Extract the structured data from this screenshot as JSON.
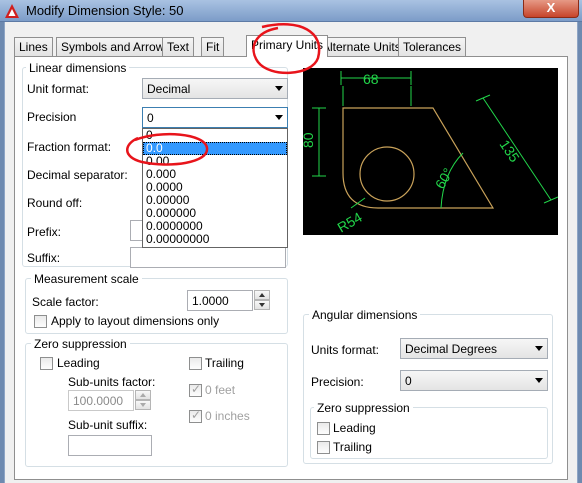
{
  "window": {
    "title": "Modify Dimension Style: 50",
    "close_label": "X"
  },
  "tabs": [
    {
      "label": "Lines",
      "active": false
    },
    {
      "label": "Symbols and Arrows",
      "active": false
    },
    {
      "label": "Text",
      "active": false
    },
    {
      "label": "Fit",
      "active": false
    },
    {
      "label": "Primary Units",
      "active": true
    },
    {
      "label": "Alternate Units",
      "active": false
    },
    {
      "label": "Tolerances",
      "active": false
    }
  ],
  "linear": {
    "title": "Linear dimensions",
    "unit_format_label": "Unit format:",
    "unit_format_value": "Decimal",
    "precision_label": "Precision",
    "precision_value": "0",
    "fraction_format_label": "Fraction format:",
    "decimal_separator_label": "Decimal separator:",
    "round_off_label": "Round off:",
    "prefix_label": "Prefix:",
    "suffix_label": "Suffix:"
  },
  "precision_options": [
    "0",
    "0.0",
    "0.00",
    "0.000",
    "0.0000",
    "0.00000",
    "0.000000",
    "0.0000000",
    "0.00000000"
  ],
  "precision_highlighted": "0.0",
  "measurement": {
    "title": "Measurement scale",
    "scale_label": "Scale factor:",
    "scale_value": "1.0000",
    "apply_layout_label": "Apply to layout dimensions only"
  },
  "zero_linear": {
    "title": "Zero suppression",
    "leading_label": "Leading",
    "trailing_label": "Trailing",
    "subunits_factor_label": "Sub-units factor:",
    "subunits_factor_value": "100.0000",
    "feet_label": "0 feet",
    "inches_label": "0 inches",
    "subunit_suffix_label": "Sub-unit suffix:"
  },
  "angular": {
    "title": "Angular dimensions",
    "units_format_label": "Units format:",
    "units_format_value": "Decimal Degrees",
    "precision_label": "Precision:",
    "precision_value": "0",
    "zero_title": "Zero suppression",
    "leading_label": "Leading",
    "trailing_label": "Trailing"
  },
  "preview": {
    "dim_top": "68",
    "dim_left": "80",
    "dim_diag": "135",
    "dim_angle": "60°",
    "dim_radius": "R54"
  },
  "colors": {
    "annotation": "#e8141b",
    "preview_dims": "#22d64a",
    "preview_geometry": "#c9a25a"
  }
}
